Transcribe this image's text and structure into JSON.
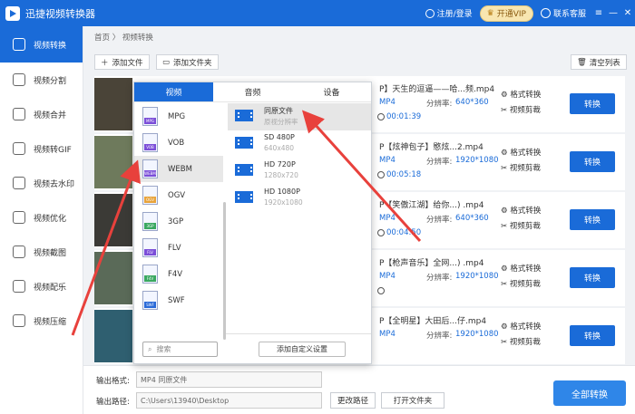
{
  "app": {
    "title": "迅捷视频转换器",
    "login": "注册/登录",
    "vip": "开通VIP",
    "contact": "联系客服",
    "win_menu": "≡",
    "win_min": "—",
    "win_close": "✕"
  },
  "sidebar": {
    "items": [
      {
        "label": "视频转换",
        "icon": "convert-icon"
      },
      {
        "label": "视频分割",
        "icon": "split-icon"
      },
      {
        "label": "视频合并",
        "icon": "merge-icon"
      },
      {
        "label": "视频转GIF",
        "icon": "gif-icon"
      },
      {
        "label": "视频去水印",
        "icon": "watermark-icon"
      },
      {
        "label": "视频优化",
        "icon": "optimize-icon"
      },
      {
        "label": "视频截图",
        "icon": "screenshot-icon"
      },
      {
        "label": "视频配乐",
        "icon": "music-icon"
      },
      {
        "label": "视频压缩",
        "icon": "compress-icon"
      }
    ]
  },
  "breadcrumb": "首页 〉 视频转换",
  "toolbar": {
    "add_file": "添加文件",
    "add_folder": "添加文件夹",
    "clear_list": "清空列表"
  },
  "rows": [
    {
      "name": "P】天生的逗逼——哈...频.mp4",
      "format": "MP4",
      "res_label": "分辨率:",
      "resolution": "640*360",
      "duration": "00:01:39",
      "act1": "格式转换",
      "act2": "视频剪裁",
      "convert": "转换"
    },
    {
      "name": "P【炫神包子】愍炫...2.mp4",
      "format": "MP4",
      "res_label": "分辨率:",
      "resolution": "1920*1080",
      "duration": "00:05:18",
      "act1": "格式转换",
      "act2": "视频剪裁",
      "convert": "转换"
    },
    {
      "name": "P【笑傲江湖】给你...) .mp4",
      "format": "MP4",
      "res_label": "分辨率:",
      "resolution": "640*360",
      "duration": "00:04:50",
      "act1": "格式转换",
      "act2": "视频剪裁",
      "convert": "转换"
    },
    {
      "name": "P【枪声音乐】全网...) .mp4",
      "format": "MP4",
      "res_label": "分辨率:",
      "resolution": "1920*1080",
      "duration": "",
      "act1": "格式转换",
      "act2": "视频剪裁",
      "convert": "转换"
    },
    {
      "name": "P【全明星】大田后...仔.mp4",
      "format": "MP4",
      "res_label": "分辨率:",
      "resolution": "1920*1080",
      "duration": "",
      "act1": "格式转换",
      "act2": "视频剪裁",
      "convert": "转换"
    }
  ],
  "bottom": {
    "format_label": "输出格式:",
    "format_value": "MP4  同原文件",
    "path_label": "输出路径:",
    "path_value": "C:\\Users\\13940\\Desktop",
    "change_path": "更改路径",
    "open_folder": "打开文件夹",
    "convert_all": "全部转换"
  },
  "popup": {
    "tabs": [
      "视频",
      "音频",
      "设备"
    ],
    "formats": [
      "MPG",
      "VOB",
      "WEBM",
      "OGV",
      "3GP",
      "FLV",
      "F4V",
      "SWF"
    ],
    "qualities": [
      {
        "name": "同原文件",
        "sub": "原视分辨率"
      },
      {
        "name": "SD 480P",
        "sub": "640x480"
      },
      {
        "name": "HD 720P",
        "sub": "1280x720"
      },
      {
        "name": "HD 1080P",
        "sub": "1920x1080"
      }
    ],
    "search_placeholder": "搜索",
    "custom_button": "添加自定义设置"
  },
  "colors": {
    "accent": "#1a6bd8",
    "arrow": "#e8413c"
  }
}
